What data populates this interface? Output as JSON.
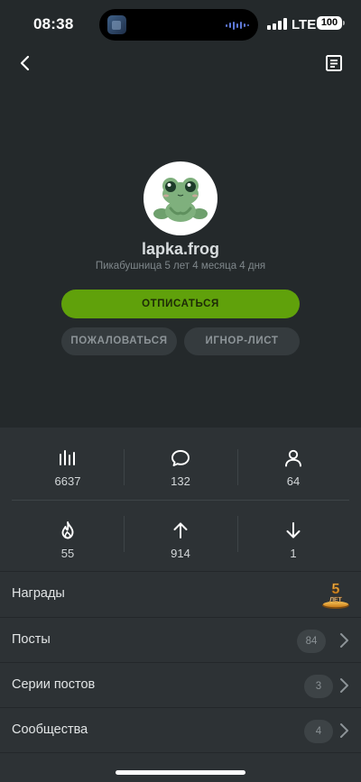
{
  "status": {
    "time": "08:38",
    "network": "LTE",
    "battery": "100"
  },
  "profile": {
    "username": "lapka.frog",
    "subtitle": "Пикабушница 5 лет 4 месяца 4 дня"
  },
  "actions": {
    "unsubscribe": "ОТПИСАТЬСЯ",
    "report": "ПОЖАЛОВАТЬСЯ",
    "ignore": "ИГНОР-ЛИСТ"
  },
  "stats": {
    "rating": "6637",
    "comments": "132",
    "subscribers": "64",
    "hot": "55",
    "pluses": "914",
    "minuses": "1"
  },
  "rows": {
    "awards": {
      "label": "Награды",
      "badge_text": "5 ЛЕТ"
    },
    "posts": {
      "label": "Посты",
      "count": "84"
    },
    "series": {
      "label": "Серии постов",
      "count": "3"
    },
    "communities": {
      "label": "Сообщества",
      "count": "4"
    }
  },
  "icons": {
    "back": "chevron-left-icon",
    "notes": "notes-icon",
    "rating": "bar-chart-icon",
    "comments": "comment-bubble-icon",
    "subscribers": "person-icon",
    "hot": "flame-icon",
    "pluses": "arrow-up-icon",
    "minuses": "arrow-down-icon"
  },
  "colors": {
    "background": "#24292b",
    "panel": "#2d3235",
    "accent_green": "#60a10b",
    "secondary_button": "#353b3e"
  }
}
